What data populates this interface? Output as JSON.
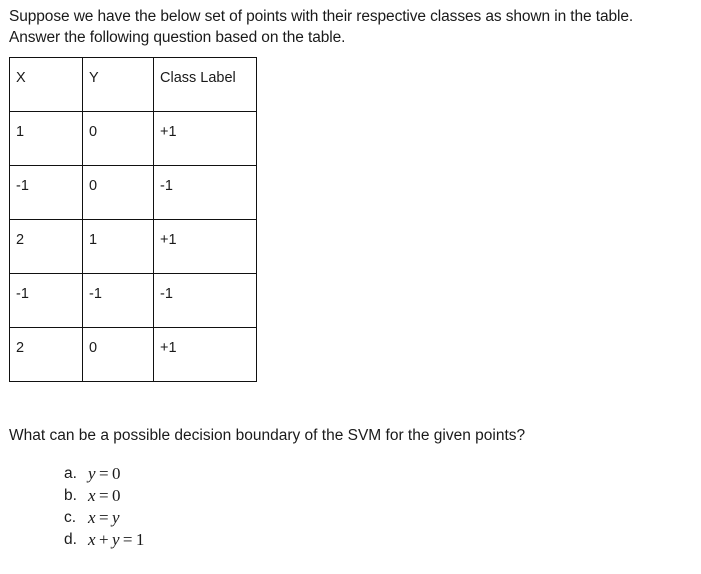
{
  "intro": {
    "line1": "Suppose we have the below set of points with their respective classes as shown in the table.",
    "line2": "Answer the following question based on the table."
  },
  "table": {
    "headers": [
      "X",
      "Y",
      "Class Label"
    ],
    "rows": [
      [
        "1",
        "0",
        "+1"
      ],
      [
        "-1",
        "0",
        "-1"
      ],
      [
        "2",
        "1",
        "+1"
      ],
      [
        "-1",
        "-1",
        "-1"
      ],
      [
        "2",
        "0",
        "+1"
      ]
    ]
  },
  "question": "What can be a possible decision boundary of the SVM for the given points?",
  "options": [
    {
      "letter": "a.",
      "expr": "y = 0"
    },
    {
      "letter": "b.",
      "expr": "x = 0"
    },
    {
      "letter": "c.",
      "expr": "x = y"
    },
    {
      "letter": "d.",
      "expr": "x + y = 1"
    }
  ]
}
